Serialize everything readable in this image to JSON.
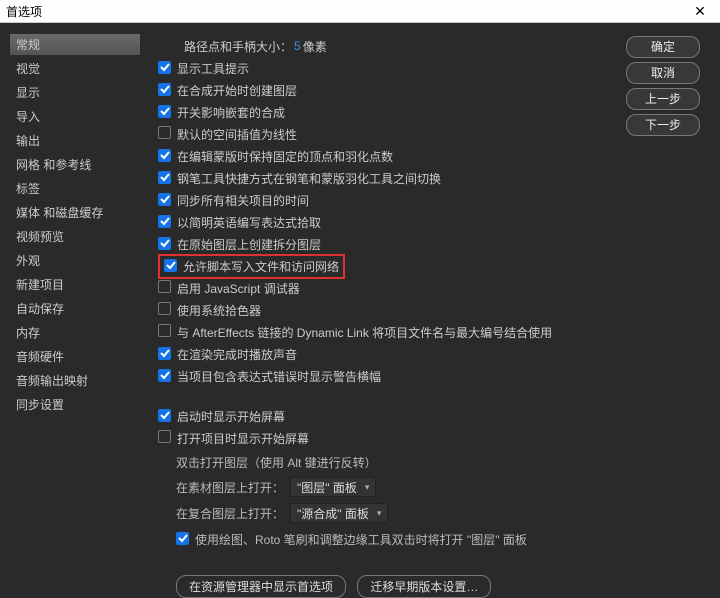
{
  "title": "首选项",
  "sidebar": {
    "items": [
      {
        "label": "常规",
        "active": true
      },
      {
        "label": "视觉"
      },
      {
        "label": "显示"
      },
      {
        "label": "导入"
      },
      {
        "label": "输出"
      },
      {
        "label": "网格 和参考线"
      },
      {
        "label": "标签"
      },
      {
        "label": "媒体 和磁盘缓存"
      },
      {
        "label": "视频预览"
      },
      {
        "label": "外观"
      },
      {
        "label": "新建项目"
      },
      {
        "label": "自动保存"
      },
      {
        "label": "内存"
      },
      {
        "label": "音频硬件"
      },
      {
        "label": "音频输出映射"
      },
      {
        "label": "同步设置"
      }
    ]
  },
  "buttons": {
    "ok": "确定",
    "cancel": "取消",
    "prev": "上一步",
    "next": "下一步"
  },
  "ruler": {
    "label_left": "路径点和手柄大小：",
    "value": "5",
    "label_right": "像素"
  },
  "opts": [
    {
      "checked": true,
      "label": "显示工具提示"
    },
    {
      "checked": true,
      "label": "在合成开始时创建图层"
    },
    {
      "checked": true,
      "label": "开关影响嵌套的合成"
    },
    {
      "checked": false,
      "label": "默认的空间插值为线性"
    },
    {
      "checked": true,
      "label": "在编辑蒙版时保持固定的顶点和羽化点数"
    },
    {
      "checked": true,
      "label": "钢笔工具快捷方式在钢笔和蒙版羽化工具之间切换"
    },
    {
      "checked": true,
      "label": "同步所有相关项目的时间"
    },
    {
      "checked": true,
      "label": "以简明英语编写表达式拾取"
    },
    {
      "checked": true,
      "label": "在原始图层上创建拆分图层"
    },
    {
      "checked": true,
      "label": "允许脚本写入文件和访问网络",
      "highlight": true
    },
    {
      "checked": false,
      "label": "启用 JavaScript 调试器"
    },
    {
      "checked": false,
      "label": "使用系统拾色器"
    },
    {
      "checked": false,
      "label": "与 AfterEffects 链接的 Dynamic Link 将项目文件名与最大编号结合使用"
    },
    {
      "checked": true,
      "label": "在渲染完成时播放声音"
    },
    {
      "checked": true,
      "label": "当项目包含表达式错误时显示警告横幅"
    }
  ],
  "opts2": [
    {
      "checked": true,
      "label": "启动时显示开始屏幕"
    },
    {
      "checked": false,
      "label": "打开项目时显示开始屏幕"
    }
  ],
  "dlayer": {
    "hint": "双击打开图层（使用 Alt 键进行反转）",
    "row1_label": "在素材图层上打开：",
    "row1_value": "\"图层\" 面板",
    "row2_label": "在复合图层上打开：",
    "row2_value": "\"源合成\" 面板",
    "row3_checked": true,
    "row3_label": "使用绘图、Roto 笔刷和调整边缘工具双击时将打开 \"图层\" 面板"
  },
  "footer": {
    "b1": "在资源管理器中显示首选项",
    "b2": "迁移早期版本设置…"
  }
}
